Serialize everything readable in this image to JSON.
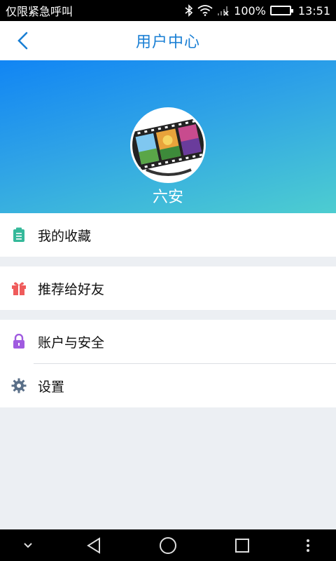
{
  "status_bar": {
    "carrier": "仅限紧急呼叫",
    "battery": "100%",
    "time": "13:51"
  },
  "header": {
    "title": "用户中心"
  },
  "profile": {
    "name": "六安"
  },
  "menu": {
    "favorites": "我的收藏",
    "recommend": "推荐给好友",
    "account_security": "账户与安全",
    "settings": "设置"
  },
  "colors": {
    "accent": "#1a7fd4",
    "favorites_icon": "#35b99a",
    "recommend_icon": "#ef5b5b",
    "security_icon": "#a05be0",
    "settings_icon": "#5a6f88"
  }
}
